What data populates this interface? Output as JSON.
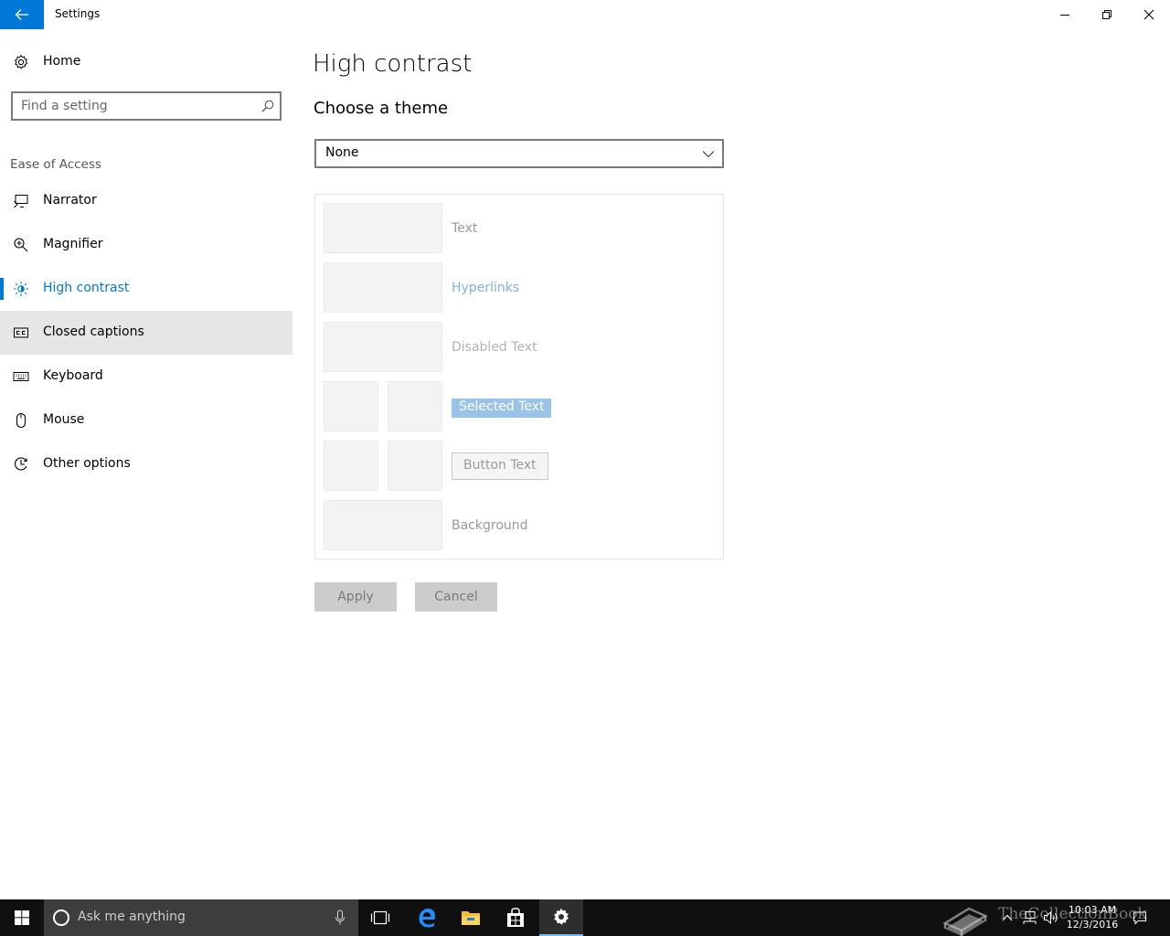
{
  "window": {
    "title": "Settings",
    "buttons": {
      "back": "back-arrow-icon",
      "minimize": "minimize-icon",
      "maximize": "restore-icon",
      "close": "close-icon"
    }
  },
  "sidebar": {
    "home": {
      "label": "Home",
      "icon": "gear-icon"
    },
    "search": {
      "placeholder": "Find a setting",
      "value": "",
      "icon": "search-icon"
    },
    "section": "Ease of Access",
    "items": [
      {
        "label": "Narrator",
        "icon": "narrator-icon",
        "state": "normal"
      },
      {
        "label": "Magnifier",
        "icon": "magnifier-icon",
        "state": "normal"
      },
      {
        "label": "High contrast",
        "icon": "high-contrast-icon",
        "state": "selected"
      },
      {
        "label": "Closed captions",
        "icon": "closed-captions-icon",
        "state": "hover"
      },
      {
        "label": "Keyboard",
        "icon": "keyboard-icon",
        "state": "normal"
      },
      {
        "label": "Mouse",
        "icon": "mouse-icon",
        "state": "normal"
      },
      {
        "label": "Other options",
        "icon": "other-options-icon",
        "state": "normal"
      }
    ]
  },
  "main": {
    "title": "High contrast",
    "section_title": "Choose a theme",
    "theme_select": {
      "value": "None"
    },
    "preview": {
      "text": "Text",
      "hyperlinks": "Hyperlinks",
      "disabled_text": "Disabled Text",
      "selected_text": "Selected Text",
      "button_text": "Button Text",
      "background": "Background"
    },
    "apply": "Apply",
    "cancel": "Cancel"
  },
  "taskbar": {
    "search_text": "Ask me anything",
    "apps": [
      "task-view-icon",
      "edge-icon",
      "file-explorer-icon",
      "store-icon",
      "settings-icon"
    ],
    "active_app": "settings-icon",
    "time": "10:03 AM",
    "date": "12/3/2016",
    "watermark": "TheCollectionBook"
  },
  "colors": {
    "accent": "#0078d7",
    "hyperlink_preview": "#7fb2dd",
    "disabled_preview": "#b3b3b3",
    "selected_bg": "#99c4e8",
    "button_gray": "#cccccc",
    "taskbar_bg": "#101010"
  }
}
